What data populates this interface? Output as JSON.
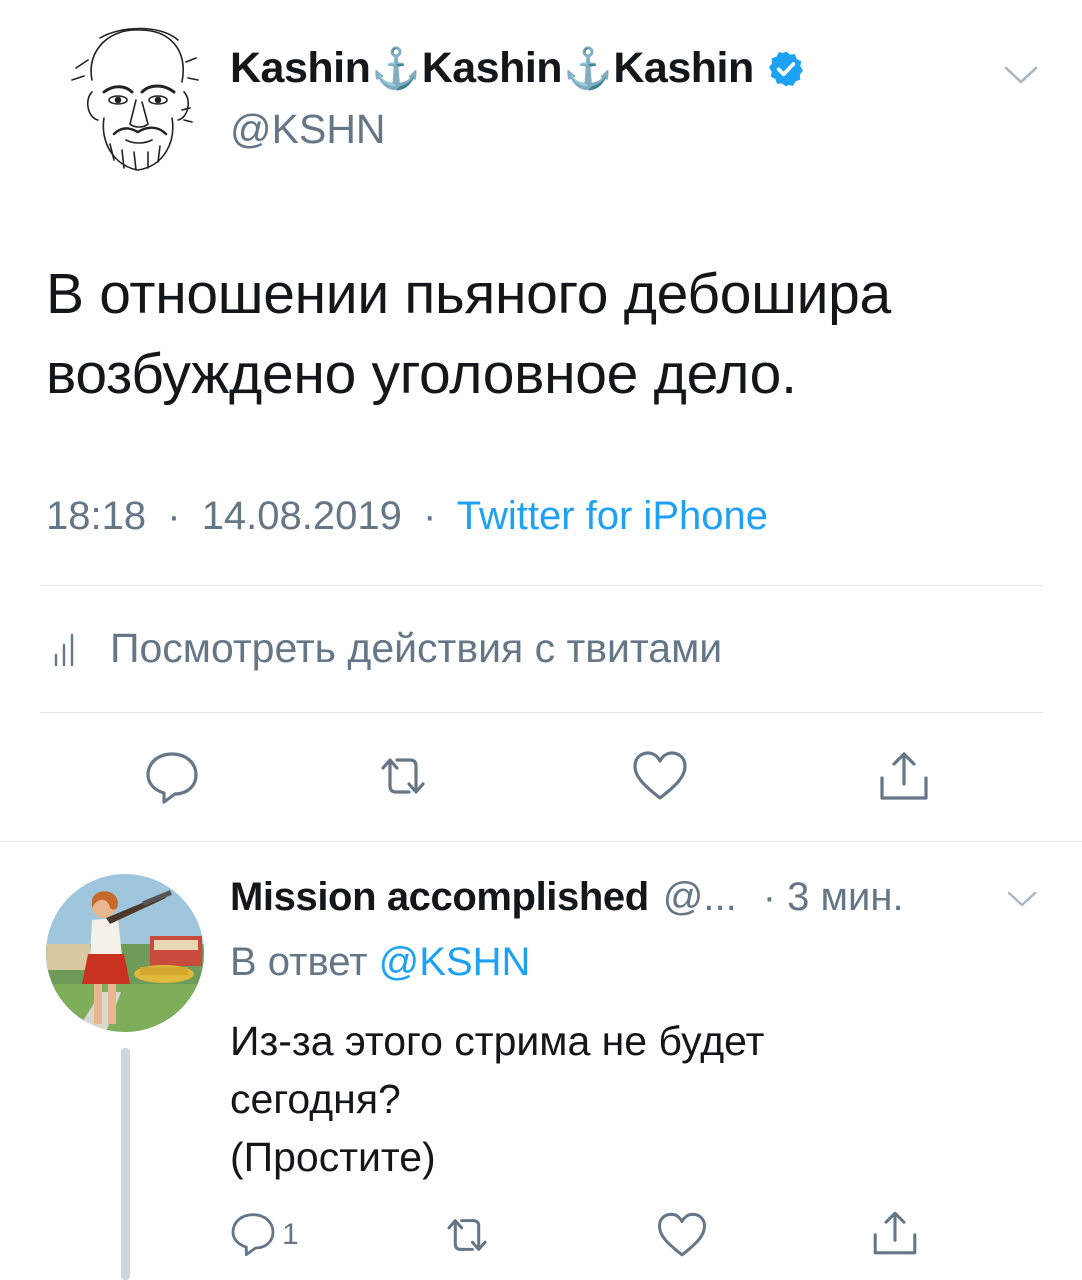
{
  "tweet": {
    "author": {
      "name_parts": [
        "Kashin",
        "Kashin",
        "Kashin"
      ],
      "anchor_glyph": "⚓",
      "handle": "@KSHN",
      "verified": true,
      "verified_color": "#1da1f2"
    },
    "text_lines": [
      "В отношении пьяного дебошира",
      "возбуждено уголовное дело."
    ],
    "time": "18:18",
    "date": "14.08.2019",
    "separator": "·",
    "source": "Twitter for iPhone",
    "activity_label": "Посмотреть действия с твитами",
    "actions": [
      "reply-icon",
      "retweet-icon",
      "like-icon",
      "share-icon"
    ]
  },
  "reply": {
    "name": "Mission accomplished",
    "handle": "@...",
    "time": "· 3 мин.",
    "reply_to_prefix": "В ответ",
    "reply_to_handle": "@KSHN",
    "text_lines": [
      "Из-за этого стрима не будет",
      "сегодня?",
      "(Простите)"
    ],
    "reply_count": "1",
    "actions": [
      "reply-icon",
      "retweet-icon",
      "like-icon",
      "share-icon"
    ]
  },
  "colors": {
    "text": "#14171a",
    "secondary": "#657786",
    "accent": "#1da1f2",
    "divider": "#e1e8ed",
    "thread_line": "#ccd6dd"
  }
}
